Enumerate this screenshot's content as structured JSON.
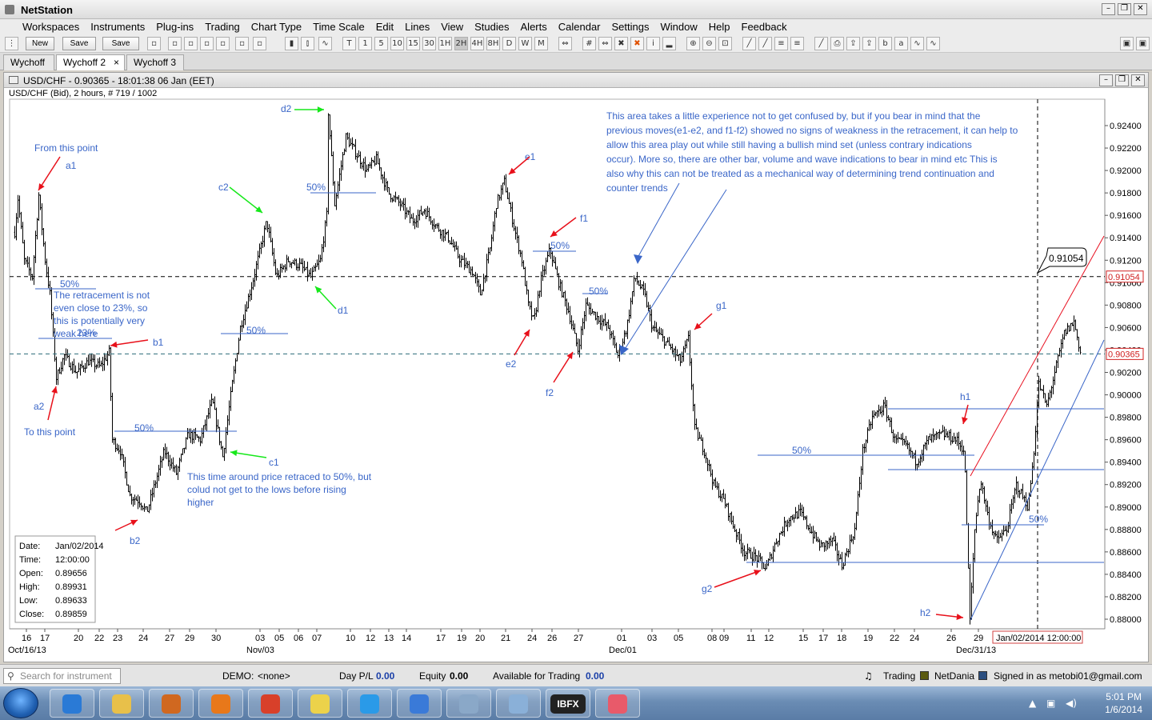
{
  "app": {
    "title": "NetStation"
  },
  "menu": [
    "Workspaces",
    "Instruments",
    "Plug-ins",
    "Trading",
    "Chart Type",
    "Time Scale",
    "Edit",
    "Lines",
    "View",
    "Studies",
    "Alerts",
    "Calendar",
    "Settings",
    "Window",
    "Help",
    "Feedback"
  ],
  "toolbar": {
    "new_label": "New",
    "save_label": "Save",
    "save_as_label": "Save as...",
    "timeframes": [
      "T",
      "1",
      "5",
      "10",
      "15",
      "30",
      "1H",
      "2H",
      "4H",
      "8H",
      "D",
      "W",
      "M"
    ],
    "icons": [
      "pointer-icon",
      "window-icon",
      "cascade-icon",
      "bar-chart-icon",
      "candlestick-icon",
      "line-chart-icon",
      "crosshair-icon",
      "cursor-icon",
      "delete-icon",
      "grid-icon",
      "info-icon",
      "volume-icon",
      "zoom-in-icon",
      "zoom-out-icon",
      "zoom-fit-icon",
      "trendline-icon",
      "fibonacci-icon",
      "print-icon",
      "export-icon",
      "bid-icon",
      "ask-icon"
    ]
  },
  "tabs": [
    {
      "label": "Wychoff",
      "active": false
    },
    {
      "label": "Wychoff 2",
      "active": true,
      "close": "×"
    },
    {
      "label": "Wychoff 3",
      "active": false
    }
  ],
  "chart_window": {
    "title": "USD/CHF - 0.90365 - 18:01:38  06 Jan (EET)",
    "subtitle": "USD/CHF (Bid), 2 hours, # 719 / 1002"
  },
  "chart_data": {
    "type": "ohlc",
    "instrument": "USD/CHF",
    "y_ticks": [
      "0.92400",
      "0.92200",
      "0.92000",
      "0.91800",
      "0.91600",
      "0.91400",
      "0.91200",
      "0.91000",
      "0.90800",
      "0.90600",
      "0.90400",
      "0.90200",
      "0.90000",
      "0.89800",
      "0.89600",
      "0.89400",
      "0.89200",
      "0.89000",
      "0.88800",
      "0.88600",
      "0.88400",
      "0.88200",
      "0.88000"
    ],
    "ylim": [
      0.88,
      0.925
    ],
    "x_ticks": [
      "16",
      "17",
      "20",
      "22",
      "23",
      "24",
      "27",
      "29",
      "30",
      "03",
      "05",
      "06",
      "07",
      "10",
      "12",
      "13",
      "14",
      "17",
      "19",
      "20",
      "21",
      "24",
      "26",
      "27",
      "01",
      "03",
      "05",
      "08",
      "09",
      "11",
      "12",
      "15",
      "17",
      "18",
      "19",
      "22",
      "24",
      "26",
      "29"
    ],
    "x_month_labels": [
      "Oct/16/13",
      "Nov/03",
      "Dec/01",
      "Dec/31/13"
    ],
    "x_cursor_label": "Jan/02/2014 12:00:00",
    "price_labels": {
      "horizontal_line": "0.91054",
      "current_bid": "0.90365",
      "callout": "0.91054"
    },
    "key_points": [
      {
        "label": "a1",
        "value": 0.9178
      },
      {
        "label": "a2",
        "value": 0.9015
      },
      {
        "label": "b1",
        "value": 0.9038
      },
      {
        "label": "b2",
        "value": 0.8895
      },
      {
        "label": "c1",
        "value": 0.8945
      },
      {
        "label": "c2",
        "value": 0.9155
      },
      {
        "label": "d1",
        "value": 0.9105
      },
      {
        "label": "d2",
        "value": 0.9252
      },
      {
        "label": "e1",
        "value": 0.919
      },
      {
        "label": "e2",
        "value": 0.9065
      },
      {
        "label": "f1",
        "value": 0.913
      },
      {
        "label": "f2",
        "value": 0.904
      },
      {
        "label": "g1",
        "value": 0.905
      },
      {
        "label": "g2",
        "value": 0.8845
      },
      {
        "label": "h1",
        "value": 0.897
      },
      {
        "label": "h2",
        "value": 0.88
      }
    ],
    "fib_labels": [
      "50%",
      "50%",
      "23%",
      "50%",
      "50%",
      "50%",
      "50%",
      "50%",
      "50%",
      "50%"
    ],
    "annotations": {
      "from_point": "From this point",
      "to_point": "To this point",
      "retracement_note": "The retracement is not even close to 23%, so this is potentially very weak here",
      "c1_note": "This time around price retraced to 50%, but colud not get to the lows before rising higher",
      "area_note": "This area takes a little experience not to get confused by, but if you bear in mind that the previous moves(e1-e2, and f1-f2) showed no signs of weakness in the retracement, it can help to allow this area play out while still having a bullish mind set (unless contrary indications occur). More so, there are other bar, volume and wave indications to bear in mind etc This is also why this can not be treated as a mechanical way of determining trend continuation and counter trends"
    },
    "data_box": {
      "date_label": "Date:",
      "date": "Jan/02/2014",
      "time_label": "Time:",
      "time": "12:00:00",
      "open_label": "Open:",
      "open": "0.89656",
      "high_label": "High:",
      "high": "0.89931",
      "low_label": "Low:",
      "low": "0.89633",
      "close_label": "Close:",
      "close": "0.89859"
    },
    "colors": {
      "annotation": "#3a66c8",
      "red_arrow": "#e8101a",
      "green_arrow": "#16e81a",
      "bars": "#000000"
    }
  },
  "status": {
    "search_placeholder": "Search for instrument",
    "demo_label": "DEMO:",
    "demo_value": "<none>",
    "daypl_label": "Day P/L",
    "daypl_value": "0.00",
    "equity_label": "Equity",
    "equity_value": "0.00",
    "avail_label": "Available for Trading",
    "avail_value": "0.00",
    "trading_label": "Trading",
    "netdania_label": "NetDania",
    "signed_in": "Signed in as metobi01@gmail.com"
  },
  "taskbar": {
    "time": "5:01 PM",
    "date": "1/6/2014",
    "apps": [
      "internet-explorer-icon",
      "file-explorer-icon",
      "media-player-icon",
      "firefox-icon",
      "chrome-icon",
      "sticky-notes-icon",
      "skype-icon",
      "thunderbird-icon",
      "netstation-icon",
      "calculator-icon",
      "ibfx-icon",
      "app-icon"
    ],
    "ibfx_label": "IBFX"
  }
}
